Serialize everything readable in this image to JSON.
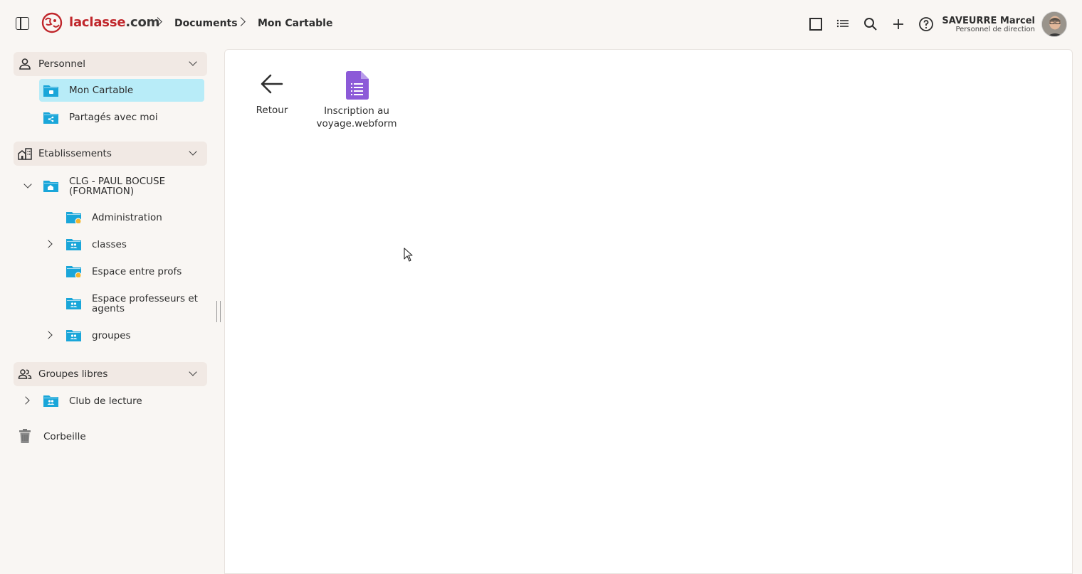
{
  "app": {
    "brand": "laclasse",
    "brand_domain": ".com",
    "brand_color": "#c0262b"
  },
  "breadcrumb": {
    "items": [
      "Documents",
      "Mon Cartable"
    ]
  },
  "user": {
    "name": "SAVEURRE Marcel",
    "role": "Personnel de direction"
  },
  "toolbar": {
    "icons": [
      "square-view-icon",
      "list-view-icon",
      "search-icon",
      "plus-icon",
      "help-icon"
    ]
  },
  "sidebar": {
    "personnel": {
      "label": "Personnel",
      "items": [
        {
          "label": "Mon Cartable",
          "selected": true
        },
        {
          "label": "Partagés avec moi"
        }
      ]
    },
    "etablissements": {
      "label": "Etablissements",
      "school": "CLG - PAUL BOCUSE (FORMATION)",
      "items": [
        {
          "label": "Administration"
        },
        {
          "label": "classes"
        },
        {
          "label": "Espace entre profs"
        },
        {
          "label": "Espace professeurs et agents"
        },
        {
          "label": "groupes"
        }
      ]
    },
    "groupes": {
      "label": "Groupes libres",
      "items": [
        {
          "label": "Club de lecture"
        }
      ]
    },
    "trash": {
      "label": "Corbeille"
    }
  },
  "main": {
    "back_label": "Retour",
    "files": [
      {
        "name": "Inscription au voyage.webform",
        "line1": "Inscription au",
        "line2": "voyage.webform"
      }
    ]
  },
  "colors": {
    "folder_blue": "#1aa6d9",
    "selected_bg": "#b8ecf8",
    "section_bg": "#f1e9e4",
    "form_purple": "#8c5ad8",
    "badge_yellow": "#f2b631"
  }
}
